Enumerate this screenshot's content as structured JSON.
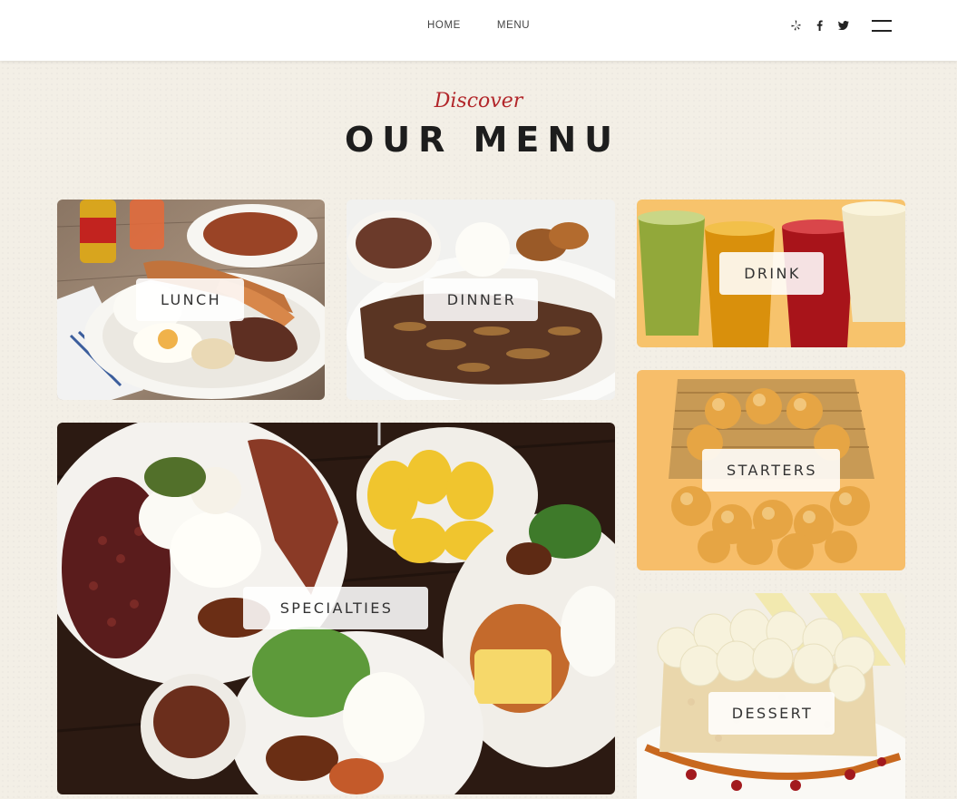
{
  "nav": {
    "home": "HOME",
    "menu": "MENU"
  },
  "social": [
    "yelp-icon",
    "facebook-icon",
    "twitter-icon"
  ],
  "heading": {
    "discover": "Discover",
    "title": "OUR MENU"
  },
  "cards": {
    "lunch": "LUNCH",
    "dinner": "DINNER",
    "drink": "DRINK",
    "starters": "STARTERS",
    "specialties": "SPECIALTIES",
    "dessert": "DESSERT"
  },
  "colors": {
    "accent": "#b2262a",
    "background": "#f3efe6",
    "header": "#ffffff",
    "title": "#1d1d1d"
  }
}
